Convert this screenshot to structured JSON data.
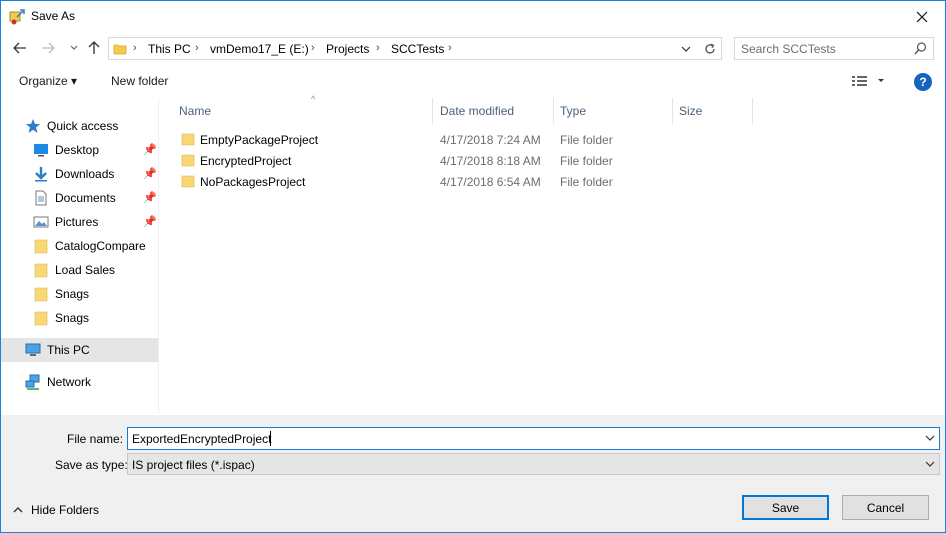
{
  "window": {
    "title": "Save As"
  },
  "address": {
    "crumbs": [
      "This PC",
      "vmDemo17_E (E:)",
      "Projects",
      "SCCTests"
    ]
  },
  "search": {
    "placeholder": "Search SCCTests"
  },
  "toolbar": {
    "organize_label": "Organize ▾",
    "new_folder_label": "New folder"
  },
  "nav": {
    "quick_access": "Quick access",
    "items": [
      {
        "label": "Desktop",
        "icon": "desktop-icon",
        "pinned": true
      },
      {
        "label": "Downloads",
        "icon": "downloads-icon",
        "pinned": true
      },
      {
        "label": "Documents",
        "icon": "documents-icon",
        "pinned": true
      },
      {
        "label": "Pictures",
        "icon": "pictures-icon",
        "pinned": true
      },
      {
        "label": "CatalogCompare",
        "icon": "folder-icon",
        "pinned": false
      },
      {
        "label": "Load Sales",
        "icon": "folder-icon",
        "pinned": false
      },
      {
        "label": "Snags",
        "icon": "folder-icon",
        "pinned": false
      },
      {
        "label": "Snags",
        "icon": "folder-icon",
        "pinned": false
      }
    ],
    "this_pc": "This PC",
    "network": "Network"
  },
  "columns": {
    "name": "Name",
    "date": "Date modified",
    "type": "Type",
    "size": "Size"
  },
  "files": [
    {
      "name": "EmptyPackageProject",
      "date": "4/17/2018 7:24 AM",
      "type": "File folder"
    },
    {
      "name": "EncryptedProject",
      "date": "4/17/2018 8:18 AM",
      "type": "File folder"
    },
    {
      "name": "NoPackagesProject",
      "date": "4/17/2018 6:54 AM",
      "type": "File folder"
    }
  ],
  "form": {
    "file_name_label": "File name:",
    "file_name_value": "ExportedEncryptedProject",
    "save_type_label": "Save as type:",
    "save_type_value": "IS project files (*.ispac)"
  },
  "footer": {
    "hide_folders": "Hide Folders",
    "save": "Save",
    "cancel": "Cancel"
  },
  "colors": {
    "accent": "#0078d7",
    "folder": "#f5c94e",
    "help": "#1565c0"
  }
}
